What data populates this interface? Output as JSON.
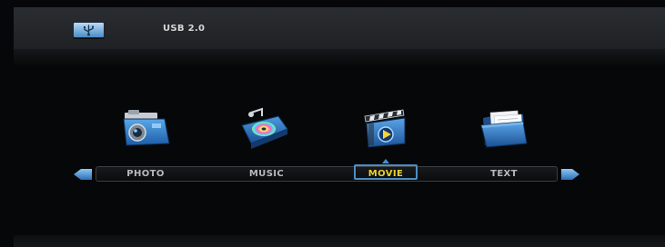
{
  "header": {
    "device_label": "USB 2.0",
    "device_icon": "usb-drive-icon"
  },
  "menu": {
    "selected": "MOVIE",
    "items": [
      {
        "label": "PHOTO",
        "icon": "camera-icon"
      },
      {
        "label": "MUSIC",
        "icon": "music-disc-icon"
      },
      {
        "label": "MOVIE",
        "icon": "clapperboard-icon"
      },
      {
        "label": "TEXT",
        "icon": "folder-documents-icon"
      }
    ],
    "left_arrow": "arrow-left-icon",
    "right_arrow": "arrow-right-icon"
  },
  "colors": {
    "selected_text": "#e8d233",
    "normal_text": "#b9b9b9",
    "accent": "#4d8ec4",
    "background": "#060708"
  }
}
